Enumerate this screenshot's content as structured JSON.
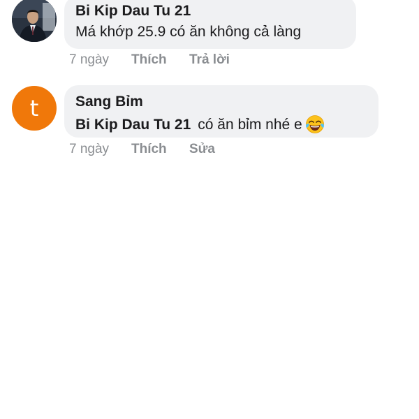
{
  "comments": [
    {
      "author": "Bi Kip Dau Tu 21",
      "text": "Má khớp 25.9 có ăn không cả làng",
      "time": "7 ngày",
      "like_label": "Thích",
      "reply_label": "Trả lời",
      "avatar_icon": "profile-photo"
    },
    {
      "author": "Sang Bỉm",
      "avatar_letter": "t",
      "avatar_color": "#f0780a",
      "mention": "Bi Kip Dau Tu 21",
      "text": "có ăn bỉm nhé e",
      "emoji": "face-with-tears-of-joy",
      "time": "7 ngày",
      "like_label": "Thích",
      "edit_label": "Sửa"
    }
  ]
}
